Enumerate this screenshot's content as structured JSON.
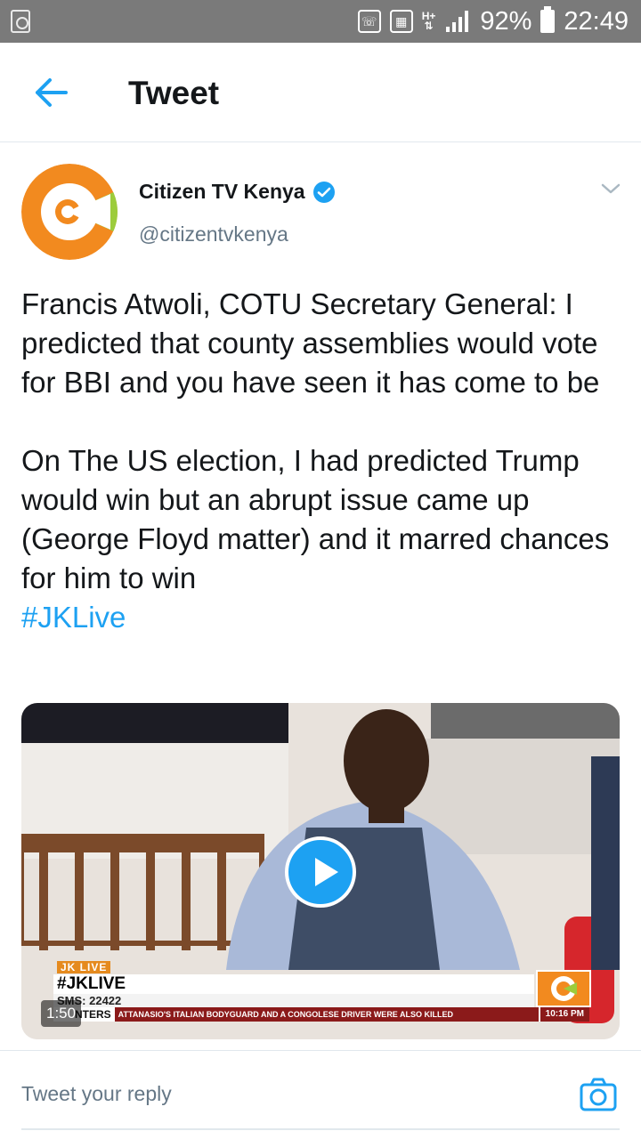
{
  "status_bar": {
    "battery": "92%",
    "time": "22:49",
    "network": "H+"
  },
  "header": {
    "title": "Tweet",
    "back_icon": "arrow-left-icon"
  },
  "tweet": {
    "author_name": "Citizen TV Kenya",
    "author_handle": "@citizentvkenya",
    "verified": true,
    "paragraph1": "Francis Atwoli, COTU Secretary General: I predicted that county assemblies would vote for BBI and you have seen it has come to be",
    "paragraph2": "On The US election, I had predicted Trump would win but an abrupt issue came up (George Floyd matter) and it marred chances for him to win",
    "hashtag": "#JKLive"
  },
  "media": {
    "duration": "1:50",
    "overlay_tag": "JK LIVE",
    "overlay_title": "#JKLIVE",
    "overlay_sms": "SMS: 22422",
    "ticker_label": "NTERS",
    "ticker_news": "ATTANASIO'S ITALIAN BODYGUARD AND A CONGOLESE DRIVER WERE ALSO KILLED",
    "ticker_time": "10:16 PM"
  },
  "reply": {
    "placeholder": "Tweet your reply"
  },
  "colors": {
    "accent": "#1da1f2",
    "status_bar": "#7a7a7a",
    "secondary_text": "#657786"
  }
}
